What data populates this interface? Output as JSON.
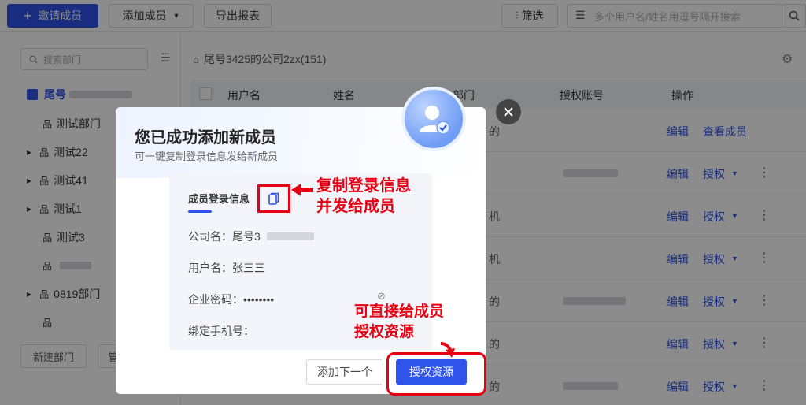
{
  "topbar": {
    "invite_label": "邀请成员",
    "add_member_label": "添加成员",
    "export_label": "导出报表",
    "filter_label": "筛选",
    "search_placeholder": "多个用户名/姓名用逗号隔开搜索"
  },
  "sidebar": {
    "search_placeholder": "搜索部门",
    "root_label": "尾号",
    "items": [
      "测试部门",
      "测试22",
      "测试41",
      "测试1",
      "测试3",
      "",
      "0819部门",
      ""
    ],
    "new_dept_label": "新建部门",
    "manage_label": "管"
  },
  "main": {
    "company_title": "尾号3425的公司2zx(151)",
    "columns": [
      "用户名",
      "姓名",
      "在部门",
      "授权账号",
      "操作"
    ],
    "row_actions": {
      "edit": "编辑",
      "view_member": "查看成员",
      "authorize": "授权"
    },
    "row_fragments": [
      "的",
      "",
      "机",
      "机",
      "的",
      "的",
      "的"
    ]
  },
  "modal": {
    "title": "您已成功添加新成员",
    "subtitle": "可一键复制登录信息发给新成员",
    "card_title": "成员登录信息",
    "company_label": "公司名：",
    "company_value": "尾号3",
    "username_label": "用户名：",
    "username_value": "张三三",
    "password_label": "企业密码：",
    "password_value": "••••••••",
    "phone_label": "绑定手机号：",
    "next_label": "添加下一个",
    "auth_label": "授权资源"
  },
  "annotations": {
    "copy_note_line1": "复制登录信息",
    "copy_note_line2": "并发给成员",
    "auth_note_line1": "可直接给成员",
    "auth_note_line2": "授权资源"
  },
  "colors": {
    "primary": "#2f54eb",
    "highlight_red": "#e60012"
  }
}
